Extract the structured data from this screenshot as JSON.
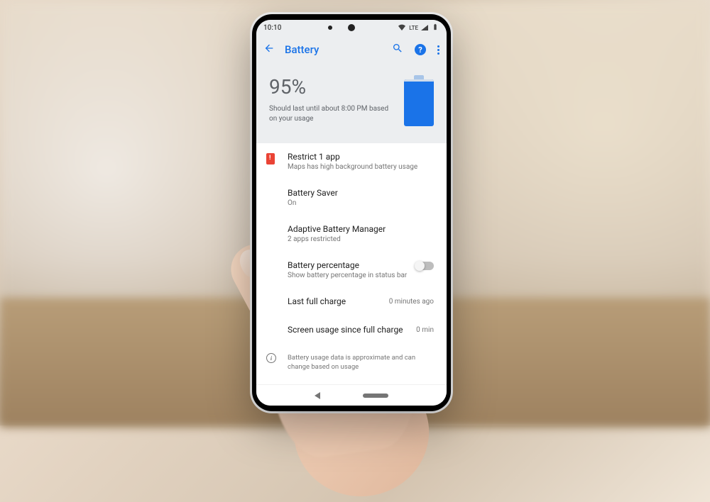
{
  "status_bar": {
    "time": "10:10",
    "network_label": "LTE"
  },
  "header": {
    "title": "Battery"
  },
  "hero": {
    "percentage": "95%",
    "estimate": "Should last until about 8:00 PM based on your usage",
    "fill_percent": 95
  },
  "settings": [
    {
      "key": "restrict",
      "title": "Restrict 1 app",
      "subtitle": "Maps has high background battery usage",
      "icon": "battery-alert"
    },
    {
      "key": "saver",
      "title": "Battery Saver",
      "subtitle": "On"
    },
    {
      "key": "adaptive",
      "title": "Adaptive Battery Manager",
      "subtitle": "2 apps restricted"
    },
    {
      "key": "percentage",
      "title": "Battery percentage",
      "subtitle": "Show battery percentage in status bar",
      "toggle": false
    },
    {
      "key": "last_charge",
      "title": "Last full charge",
      "value": "0 minutes ago"
    },
    {
      "key": "screen_usage",
      "title": "Screen usage since full charge",
      "value": "0 min"
    }
  ],
  "info_note": "Battery usage data is approximate and can change based on usage",
  "colors": {
    "accent": "#1a73e8",
    "alert": "#ea4335"
  }
}
